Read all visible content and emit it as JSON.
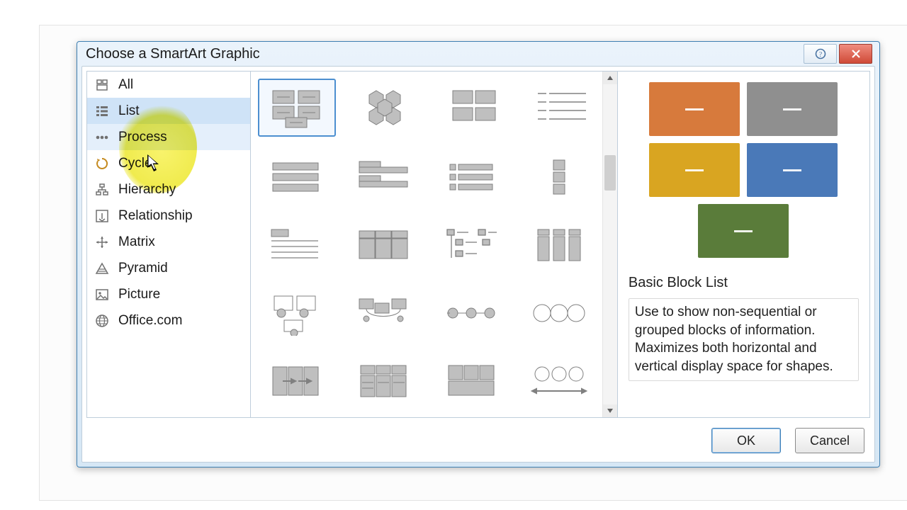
{
  "dialog": {
    "title": "Choose a SmartArt Graphic",
    "categories": [
      {
        "id": "all",
        "label": "All"
      },
      {
        "id": "list",
        "label": "List"
      },
      {
        "id": "process",
        "label": "Process"
      },
      {
        "id": "cycle",
        "label": "Cycle"
      },
      {
        "id": "hierarchy",
        "label": "Hierarchy"
      },
      {
        "id": "relationship",
        "label": "Relationship"
      },
      {
        "id": "matrix",
        "label": "Matrix"
      },
      {
        "id": "pyramid",
        "label": "Pyramid"
      },
      {
        "id": "picture",
        "label": "Picture"
      },
      {
        "id": "office",
        "label": "Office.com"
      }
    ],
    "preview": {
      "title": "Basic Block List",
      "description": "Use to show non-sequential or grouped blocks of information. Maximizes both horizontal and vertical display space for shapes.",
      "blocks": [
        {
          "color": "#d77a3c"
        },
        {
          "color": "#8f8f8f"
        },
        {
          "color": "#d9a521"
        },
        {
          "color": "#4a79b8"
        },
        {
          "color": "#5a7c3a"
        }
      ]
    },
    "buttons": {
      "ok": "OK",
      "cancel": "Cancel"
    }
  }
}
